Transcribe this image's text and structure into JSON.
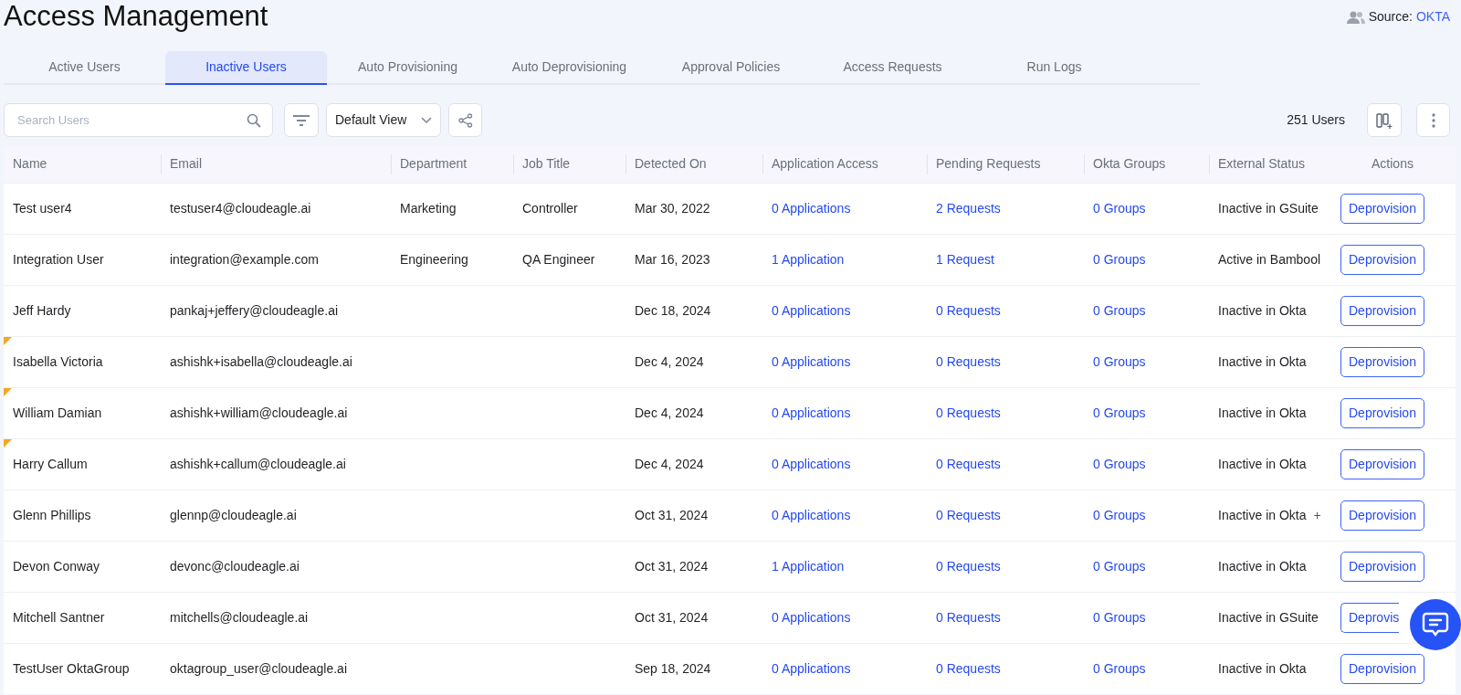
{
  "title": "Access Management",
  "source": {
    "label": "Source:",
    "value": "OKTA"
  },
  "tabs": [
    {
      "label": "Active Users",
      "selected": false
    },
    {
      "label": "Inactive Users",
      "selected": true
    },
    {
      "label": "Auto Provisioning",
      "selected": false
    },
    {
      "label": "Auto Deprovisioning",
      "selected": false
    },
    {
      "label": "Approval Policies",
      "selected": false
    },
    {
      "label": "Access Requests",
      "selected": false
    },
    {
      "label": "Run Logs",
      "selected": false
    }
  ],
  "toolbar": {
    "search_placeholder": "Search Users",
    "view": "Default View",
    "count": "251 Users"
  },
  "table": {
    "columns": [
      "Name",
      "Email",
      "Department",
      "Job Title",
      "Detected On",
      "Application Access",
      "Pending Requests",
      "Okta Groups",
      "External Status",
      "Actions"
    ],
    "rows": [
      {
        "name": "Test user4",
        "email": "testuser4@cloudeagle.ai",
        "department": "Marketing",
        "job_title": "Controller",
        "detected_on": "Mar 30, 2022",
        "applications": "0 Applications",
        "requests": "2 Requests",
        "groups": "0 Groups",
        "external_status": "Inactive in GSuite",
        "action": "Deprovision",
        "flagged": false
      },
      {
        "name": "Integration User",
        "email": "integration@example.com",
        "department": "Engineering",
        "job_title": "QA Engineer",
        "detected_on": "Mar 16, 2023",
        "applications": "1 Application",
        "requests": "1 Request",
        "groups": "0 Groups",
        "external_status": "Active in Bambool",
        "action": "Deprovision",
        "flagged": false
      },
      {
        "name": "Jeff Hardy",
        "email": "pankaj+jeffery@cloudeagle.ai",
        "detected_on": "Dec 18, 2024",
        "applications": "0 Applications",
        "requests": "0 Requests",
        "groups": "0 Groups",
        "external_status": "Inactive in Okta",
        "action": "Deprovision",
        "flagged": false
      },
      {
        "name": "Isabella Victoria",
        "email": "ashishk+isabella@cloudeagle.ai",
        "detected_on": "Dec 4, 2024",
        "applications": "0 Applications",
        "requests": "0 Requests",
        "groups": "0 Groups",
        "external_status": "Inactive in Okta",
        "action": "Deprovision",
        "flagged": true
      },
      {
        "name": "William Damian",
        "email": "ashishk+william@cloudeagle.ai",
        "detected_on": "Dec 4, 2024",
        "applications": "0 Applications",
        "requests": "0 Requests",
        "groups": "0 Groups",
        "external_status": "Inactive in Okta",
        "action": "Deprovision",
        "flagged": true
      },
      {
        "name": "Harry Callum",
        "email": "ashishk+callum@cloudeagle.ai",
        "detected_on": "Dec 4, 2024",
        "applications": "0 Applications",
        "requests": "0 Requests",
        "groups": "0 Groups",
        "external_status": "Inactive in Okta",
        "action": "Deprovision",
        "flagged": true
      },
      {
        "name": "Glenn Phillips",
        "email": "glennp@cloudeagle.ai",
        "detected_on": "Oct 31, 2024",
        "applications": "0 Applications",
        "requests": "0 Requests",
        "groups": "0 Groups",
        "external_status": "Inactive in Okta",
        "external_more": "+",
        "action": "Deprovision",
        "flagged": false
      },
      {
        "name": "Devon Conway",
        "email": "devonc@cloudeagle.ai",
        "detected_on": "Oct 31, 2024",
        "applications": "1 Application",
        "requests": "0 Requests",
        "groups": "0 Groups",
        "external_status": "Inactive in Okta",
        "action": "Deprovision",
        "flagged": false
      },
      {
        "name": "Mitchell Santner",
        "email": "mitchells@cloudeagle.ai",
        "detected_on": "Oct 31, 2024",
        "applications": "0 Applications",
        "requests": "0 Requests",
        "groups": "0 Groups",
        "external_status": "Inactive in GSuite",
        "action": "Deprovis",
        "flagged": false
      },
      {
        "name": "TestUser OktaGroup",
        "email": "oktagroup_user@cloudeagle.ai",
        "detected_on": "Sep 18, 2024",
        "applications": "0 Applications",
        "requests": "0 Requests",
        "groups": "0 Groups",
        "external_status": "Inactive in Okta",
        "action": "Deprovision",
        "flagged": false
      }
    ]
  }
}
